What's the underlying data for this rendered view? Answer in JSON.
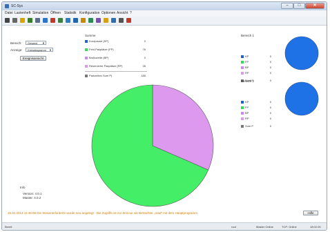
{
  "window": {
    "title": "SC-Sys"
  },
  "controls": {
    "min": "–",
    "max": "□",
    "close": "✕"
  },
  "menu": [
    "Datei",
    "Lastenheft",
    "Simulation",
    "Öffnen",
    "Statistik",
    "Konfiguration",
    "Optionen",
    "Ansicht",
    "?"
  ],
  "toolbar_icons": [
    {
      "name": "print-icon",
      "color": "#444444"
    },
    {
      "name": "gear-icon",
      "color": "#666666"
    },
    {
      "name": "chart-icon",
      "color": "#d9a400"
    },
    {
      "name": "table-icon",
      "color": "#3b7d2e"
    },
    {
      "name": "users-icon",
      "color": "#5a6d8a"
    },
    {
      "name": "bars-icon",
      "color": "#2d74c9"
    },
    {
      "name": "tools-icon",
      "color": "#c0392b"
    },
    {
      "name": "grid-icon",
      "color": "#3f7f3f"
    },
    {
      "name": "sum-icon",
      "color": "#2c7fbf"
    },
    {
      "name": "save-icon",
      "color": "#2266aa"
    },
    {
      "name": "filter-icon",
      "color": "#c48a00"
    },
    {
      "name": "refresh-icon",
      "color": "#2e8b57"
    },
    {
      "name": "settings-icon",
      "color": "#7a4fb2"
    },
    {
      "name": "clock-icon",
      "color": "#d4a017"
    },
    {
      "name": "link-icon",
      "color": "#2f6fb0"
    },
    {
      "name": "list-icon",
      "color": "#555555"
    },
    {
      "name": "warning-icon",
      "color": "#c0392b"
    }
  ],
  "controls_panel": {
    "bereich_label": "Bereich:",
    "bereich_value": "Gesamt",
    "anzeige_label": "Anzeige:",
    "anzeige_value": "Kreisdiagramm",
    "button": "Ereignisansicht"
  },
  "legend": {
    "title": "Summe",
    "rows": [
      {
        "label": "Kurzpause (KP)",
        "value": "0",
        "color": "#1f5fd6"
      },
      {
        "label": "Fehl-Pakplätze (FP)",
        "value": "76",
        "color": "#33dd55"
      },
      {
        "label": "Bruttozeite (BP)",
        "value": "0",
        "color": "#cc88ee"
      },
      {
        "label": "Reservierte Pakplätze (RP)",
        "value": "35",
        "color": "#dd99ee"
      }
    ],
    "total": {
      "label": "Parkzeiten Sum P)",
      "value": "185",
      "color": "#777777"
    }
  },
  "bereich1": {
    "title": "Bereich 1",
    "rows": [
      {
        "label": "KP",
        "value": "0",
        "color": "#1f5fd6"
      },
      {
        "label": "FP",
        "value": "0",
        "color": "#33dd55"
      },
      {
        "label": "BP",
        "value": "0",
        "color": "#cc88ee"
      },
      {
        "label": "RP",
        "value": "0",
        "color": "#dd99ee"
      }
    ],
    "total": {
      "label": "Sum P",
      "value": "0",
      "color": "#777777"
    }
  },
  "bereich2": {
    "title": "Bereich 2",
    "rows": [
      {
        "label": "KP",
        "value": "0",
        "color": "#1f5fd6"
      },
      {
        "label": "FP",
        "value": "0",
        "color": "#33dd55"
      },
      {
        "label": "BP",
        "value": "0",
        "color": "#cc88ee"
      },
      {
        "label": "RP",
        "value": "0",
        "color": "#dd99ee"
      }
    ],
    "total": {
      "label": "Sum P",
      "value": "0",
      "color": "#777777"
    }
  },
  "chart_data": {
    "type": "pie",
    "slices": [
      {
        "label": "FP",
        "value": 76,
        "color": "#44ee66"
      },
      {
        "label": "RP",
        "value": 35,
        "color": "#dd99ee"
      }
    ]
  },
  "mini_pie_color": "#1e72e6",
  "info": {
    "title": "Info",
    "version": "Version: 4.0.1",
    "master": "Master: 4.0.2"
  },
  "message": "15.01.2014 11:46:08 Die Steueranforderte wurde neu angelegt - Die Zugriffe ist zur Zeit nur als Betrachter „read“ mit dem Hauptprogramm",
  "message_button": "Hilfe",
  "statusbar": {
    "left": "Bereit",
    "user": "root",
    "master": "Master Online",
    "tcp": "TCP: Online",
    "time": "18:02:26"
  }
}
